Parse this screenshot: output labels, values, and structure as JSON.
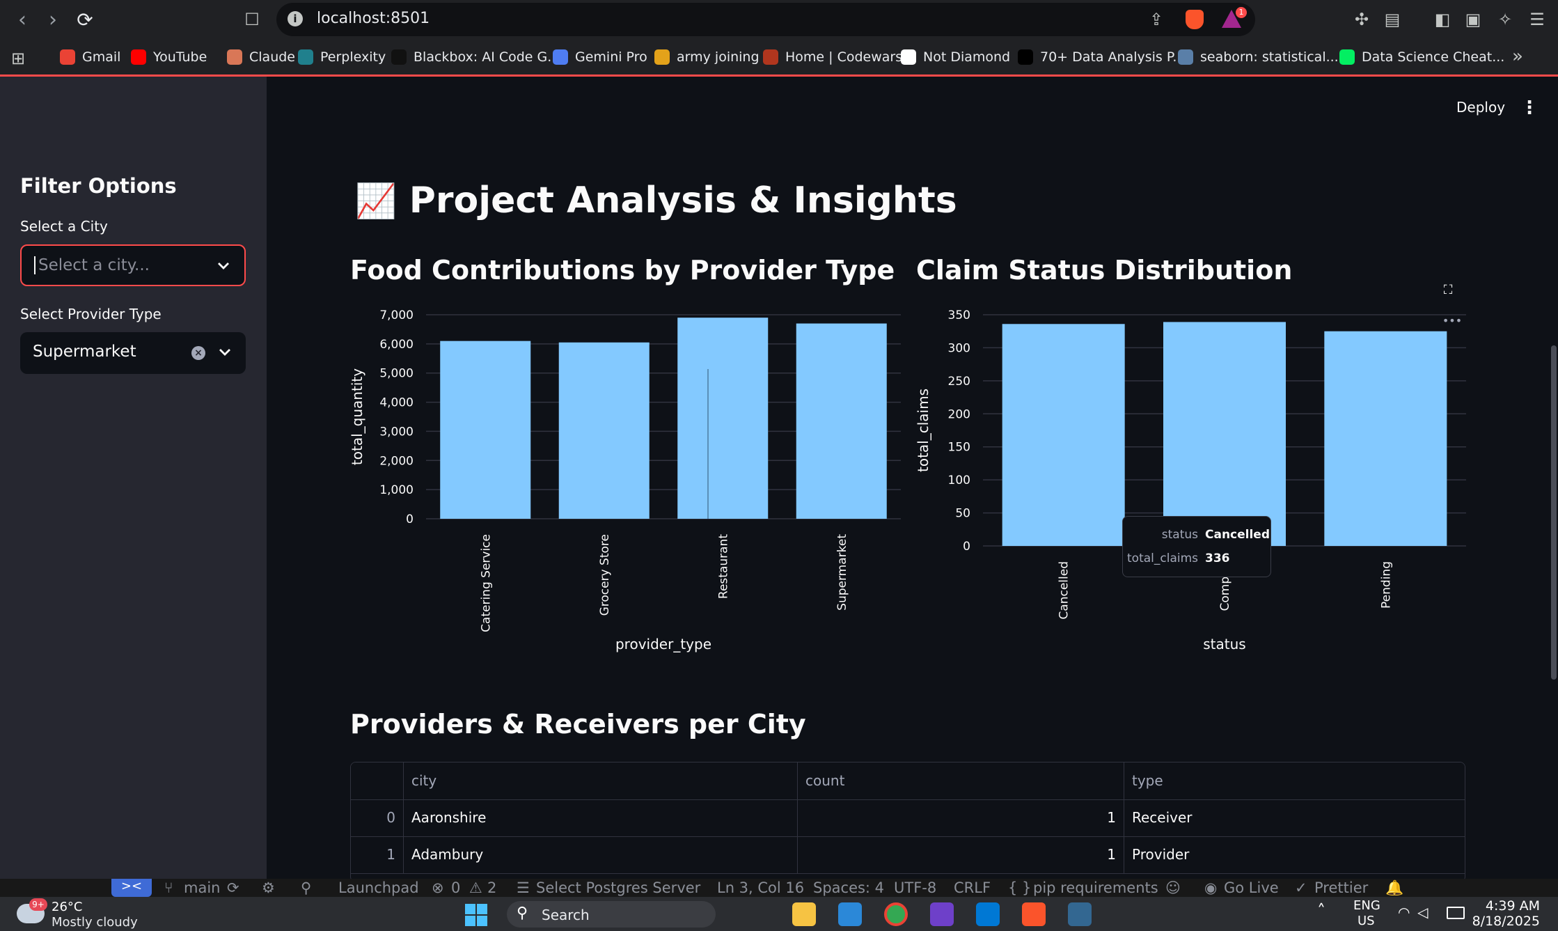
{
  "browser": {
    "url": "localhost:8501",
    "notification_count": "1",
    "bookmarks": [
      {
        "label": "Gmail",
        "icon": "gmail-icon",
        "color": "#ea4335"
      },
      {
        "label": "YouTube",
        "icon": "youtube-icon",
        "color": "#ff0000"
      },
      {
        "label": "Claude",
        "icon": "claude-icon",
        "color": "#d97757"
      },
      {
        "label": "Perplexity",
        "icon": "perplexity-icon",
        "color": "#20808d"
      },
      {
        "label": "Blackbox: AI Code G...",
        "icon": "blackbox-icon",
        "color": "#111111"
      },
      {
        "label": "Gemini Pro",
        "icon": "gemini-icon",
        "color": "#4f7df2"
      },
      {
        "label": "army joining",
        "icon": "army-icon",
        "color": "#e3a21a"
      },
      {
        "label": "Home | Codewars",
        "icon": "codewars-icon",
        "color": "#b1361e"
      },
      {
        "label": "Not Diamond",
        "icon": "notdiamond-icon",
        "color": "#ffffff"
      },
      {
        "label": "70+ Data Analysis P...",
        "icon": "medium-icon",
        "color": "#000000"
      },
      {
        "label": "seaborn: statistical...",
        "icon": "seaborn-icon",
        "color": "#5a7fa8"
      },
      {
        "label": "Data Science Cheat...",
        "icon": "datacamp-icon",
        "color": "#03ef62"
      }
    ]
  },
  "app": {
    "deploy_label": "Deploy",
    "sidebar": {
      "title": "Filter Options",
      "city_label": "Select a City",
      "city_placeholder": "Select a city...",
      "provider_label": "Select Provider Type",
      "provider_value": "Supermarket"
    },
    "title_emoji": "📈",
    "title": "Project Analysis & Insights",
    "chart1_heading": "Food Contributions by Provider Type",
    "chart2_heading": "Claim Status Distribution",
    "table_heading": "Providers & Receivers per City",
    "tooltip": {
      "k1": "status",
      "v1": "Cancelled",
      "k2": "total_claims",
      "v2": "336"
    },
    "table": {
      "columns": [
        "",
        "city",
        "count",
        "type"
      ],
      "rows": [
        [
          "0",
          "Aaronshire",
          "1",
          "Receiver"
        ],
        [
          "1",
          "Adambury",
          "1",
          "Provider"
        ]
      ]
    }
  },
  "chart_data": [
    {
      "type": "bar",
      "title": "Food Contributions by Provider Type",
      "xlabel": "provider_type",
      "ylabel": "total_quantity",
      "categories": [
        "Catering Service",
        "Grocery Store",
        "Restaurant",
        "Supermarket"
      ],
      "values": [
        6100,
        6050,
        6900,
        6700
      ],
      "ylim": [
        0,
        7000
      ],
      "yticks": [
        "0",
        "1,000",
        "2,000",
        "3,000",
        "4,000",
        "5,000",
        "6,000",
        "7,000"
      ],
      "bar_color": "#83c9ff",
      "grid": true
    },
    {
      "type": "bar",
      "title": "Claim Status Distribution",
      "xlabel": "status",
      "ylabel": "total_claims",
      "categories": [
        "Cancelled",
        "Complet",
        "Pending"
      ],
      "values": [
        336,
        339,
        325
      ],
      "ylim": [
        0,
        350
      ],
      "yticks": [
        "0",
        "50",
        "100",
        "150",
        "200",
        "250",
        "300",
        "350"
      ],
      "bar_color": "#83c9ff",
      "grid": true
    }
  ],
  "statusbar": {
    "branch": "main",
    "launchpad": "Launchpad",
    "errors": "0",
    "warnings": "2",
    "db": "Select Postgres Server",
    "cursor": "Ln 3, Col 16",
    "spaces": "Spaces: 4",
    "encoding": "UTF-8",
    "eol": "CRLF",
    "language": "pip requirements",
    "golive": "Go Live",
    "prettier": "Prettier"
  },
  "taskbar": {
    "weather_badge": "9+",
    "temperature": "26°C",
    "weather": "Mostly cloudy",
    "search": "Search",
    "lang1": "ENG",
    "lang2": "US",
    "time": "4:39 AM",
    "date": "8/18/2025"
  }
}
